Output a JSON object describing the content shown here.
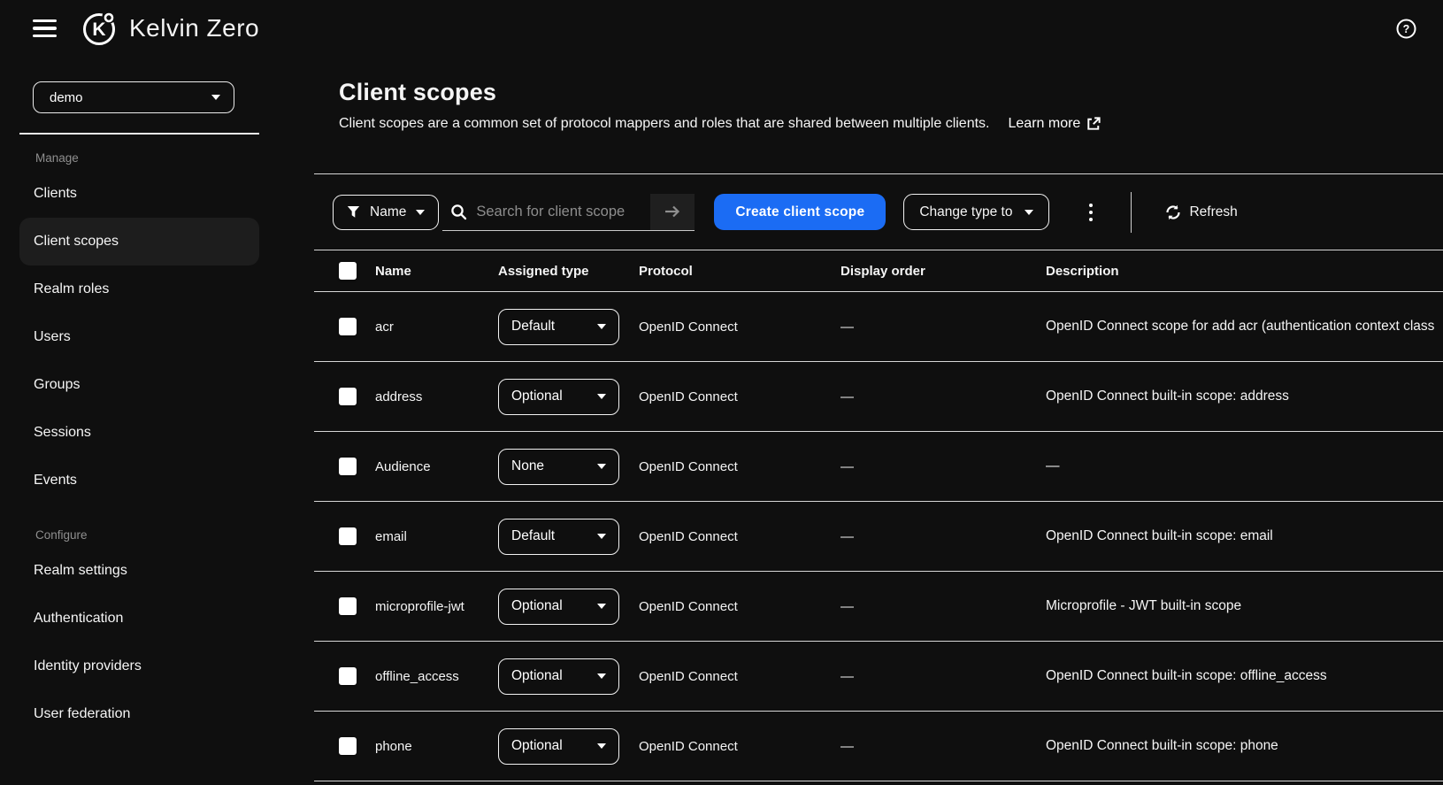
{
  "colors": {
    "accent": "#1b6cf4",
    "background": "#0f0f0f",
    "divider": "#d6d6d6",
    "highlight": "#1d1d1d",
    "muted_text": "#8f8f8f"
  },
  "header": {
    "brand": "Kelvin Zero",
    "logo_glyph": "K",
    "help_glyph": "?"
  },
  "sidebar": {
    "realm_selector": {
      "value": "demo"
    },
    "sections": [
      {
        "label": "Manage",
        "items": [
          {
            "label": "Clients",
            "active": false
          },
          {
            "label": "Client scopes",
            "active": true
          },
          {
            "label": "Realm roles",
            "active": false
          },
          {
            "label": "Users",
            "active": false
          },
          {
            "label": "Groups",
            "active": false
          },
          {
            "label": "Sessions",
            "active": false
          },
          {
            "label": "Events",
            "active": false
          }
        ]
      },
      {
        "label": "Configure",
        "items": [
          {
            "label": "Realm settings",
            "active": false
          },
          {
            "label": "Authentication",
            "active": false
          },
          {
            "label": "Identity providers",
            "active": false
          },
          {
            "label": "User federation",
            "active": false
          }
        ]
      }
    ]
  },
  "page": {
    "title": "Client scopes",
    "description": "Client scopes are a common set of protocol mappers and roles that are shared between multiple clients.",
    "learn_more_label": "Learn more"
  },
  "toolbar": {
    "filter_dropdown_label": "Name",
    "search_placeholder": "Search for client scope",
    "create_button_label": "Create client scope",
    "change_type_label": "Change type to",
    "refresh_label": "Refresh"
  },
  "table": {
    "columns": [
      "Name",
      "Assigned type",
      "Protocol",
      "Display order",
      "Description"
    ],
    "rows": [
      {
        "name": "acr",
        "assigned_type": "Default",
        "protocol": "OpenID Connect",
        "display_order": "—",
        "description": "OpenID Connect scope for add acr (authentication context class"
      },
      {
        "name": "address",
        "assigned_type": "Optional",
        "protocol": "OpenID Connect",
        "display_order": "—",
        "description": "OpenID Connect built-in scope: address"
      },
      {
        "name": "Audience",
        "assigned_type": "None",
        "protocol": "OpenID Connect",
        "display_order": "—",
        "description": "—"
      },
      {
        "name": "email",
        "assigned_type": "Default",
        "protocol": "OpenID Connect",
        "display_order": "—",
        "description": "OpenID Connect built-in scope: email"
      },
      {
        "name": "microprofile-jwt",
        "assigned_type": "Optional",
        "protocol": "OpenID Connect",
        "display_order": "—",
        "description": "Microprofile - JWT built-in scope"
      },
      {
        "name": "offline_access",
        "assigned_type": "Optional",
        "protocol": "OpenID Connect",
        "display_order": "—",
        "description": "OpenID Connect built-in scope: offline_access"
      },
      {
        "name": "phone",
        "assigned_type": "Optional",
        "protocol": "OpenID Connect",
        "display_order": "—",
        "description": "OpenID Connect built-in scope: phone"
      }
    ]
  }
}
